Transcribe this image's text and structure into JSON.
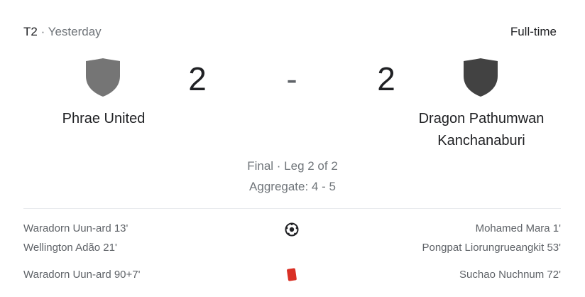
{
  "header": {
    "competition": "T2",
    "separator": "·",
    "when": "Yesterday",
    "status": "Full-time"
  },
  "match": {
    "home": {
      "name": "Phrae United",
      "score": "2",
      "crest_icon": "shield-icon",
      "crest_color": "#757575"
    },
    "away": {
      "name_line1": "Dragon Pathumwan",
      "name_line2": "Kanchanaburi",
      "score": "2",
      "crest_icon": "shield-icon",
      "crest_color": "#424242"
    },
    "score_separator": "-",
    "leg_info": "Final · Leg 2 of 2",
    "aggregate": "Aggregate: 4 - 5"
  },
  "events": {
    "goals": {
      "icon": "soccer-ball-icon",
      "home": [
        "Waradorn Uun-ard 13'",
        "Wellington Adão 21'"
      ],
      "away": [
        "Mohamed Mara 1'",
        "Pongpat Liorungrueangkit 53'"
      ]
    },
    "red_cards": {
      "icon": "red-card-icon",
      "color": "#d93025",
      "home": [
        "Waradorn Uun-ard 90+7'"
      ],
      "away": [
        "Suchao Nuchnum 72'"
      ]
    }
  }
}
